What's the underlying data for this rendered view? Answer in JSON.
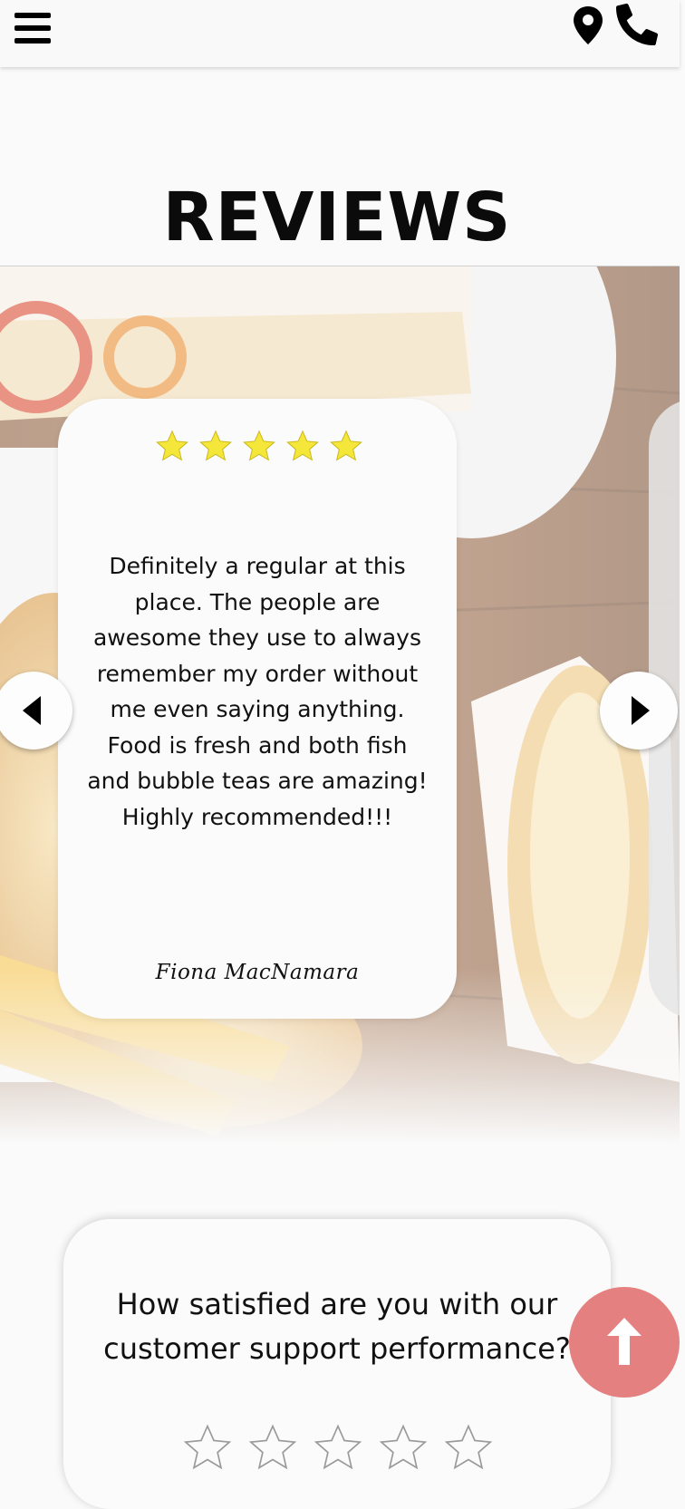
{
  "header": {
    "menu_icon": "hamburger-menu-icon",
    "location_icon": "map-pin-icon",
    "phone_icon": "phone-icon"
  },
  "reviews": {
    "title": "REVIEWS",
    "current": {
      "rating": 5,
      "text": "Definitely a regular at this place. The people are awesome they use to always remember my order without me even saying anything. Food is fresh and both fish and bubble teas are amazing! Highly recommended!!!",
      "author": "Fiona MacNamara"
    },
    "prev_icon": "caret-left-icon",
    "next_icon": "caret-right-icon"
  },
  "survey": {
    "question": "How satisfied are you with our customer support performance?",
    "rating_max": 5,
    "rating_value": 0
  },
  "scroll_top_icon": "arrow-up-icon",
  "colors": {
    "star_filled": "#f5e63a",
    "scroll_top_bg": "#e58080",
    "card_bg": "#fbfbfb"
  }
}
